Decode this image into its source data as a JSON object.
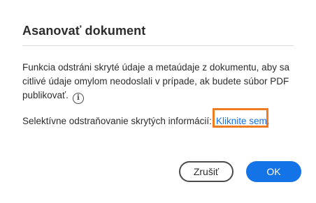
{
  "dialog": {
    "title": "Asanovať dokument",
    "description": "Funkcia odstráni skryté údaje a metaúdaje z dokumentu, aby sa citlivé údaje omylom neodoslali v prípade, ak budete súbor PDF publikovať.",
    "info_icon": "info-icon",
    "selective_text": "Selektívne odstraňovanie skrytých informácií:",
    "link_text": "Kliknite sem.",
    "highlight_color": "#f07c22"
  },
  "buttons": {
    "cancel_label": "Zrušiť",
    "ok_label": "OK"
  },
  "colors": {
    "accent": "#1473e6",
    "link": "#1473e6"
  }
}
